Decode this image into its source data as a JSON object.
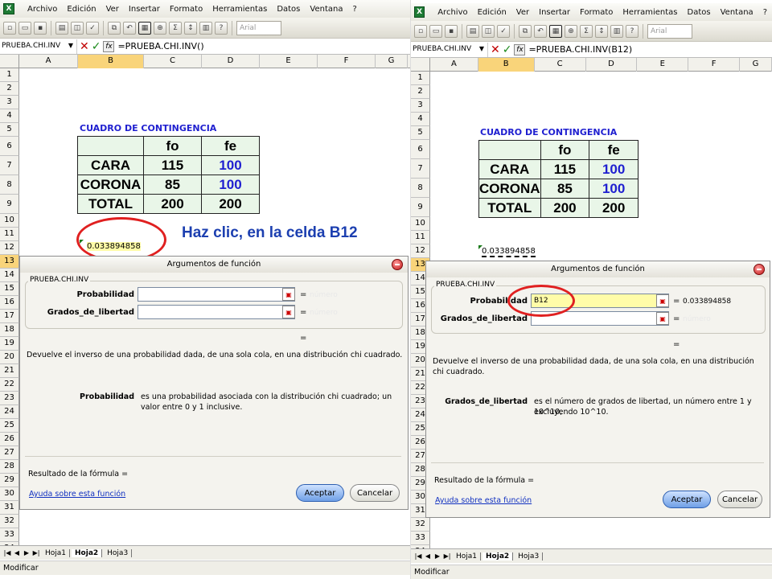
{
  "menu": [
    "Archivo",
    "Edición",
    "Ver",
    "Insertar",
    "Formato",
    "Herramientas",
    "Datos",
    "Ventana",
    "?"
  ],
  "font_name": "Arial",
  "columns": [
    "A",
    "B",
    "C",
    "D",
    "E",
    "F",
    "G"
  ],
  "rows": [
    "1",
    "2",
    "3",
    "4",
    "5",
    "6",
    "7",
    "8",
    "9",
    "10",
    "11",
    "12",
    "13",
    "14",
    "15",
    "16",
    "17",
    "18",
    "19",
    "20",
    "21",
    "22",
    "23",
    "24",
    "25",
    "26",
    "27",
    "28",
    "29",
    "30",
    "31",
    "32",
    "33",
    "34"
  ],
  "contingency": {
    "title": "CUADRO DE CONTINGENCIA",
    "headers": [
      "",
      "fo",
      "fe"
    ],
    "rows": [
      [
        "CARA",
        "115",
        "100"
      ],
      [
        "CORONA",
        "85",
        "100"
      ],
      [
        "TOTAL",
        "200",
        "200"
      ]
    ]
  },
  "cell_b12": "0.033894858",
  "sheet_tabs": [
    "Hoja1",
    "Hoja2",
    "Hoja3"
  ],
  "status": "Modificar",
  "left": {
    "namebox": "PRUEBA.CHI.INV",
    "formula": "=PRUEBA.CHI.INV()",
    "annotation": "Haz clic, en la celda B12",
    "dialog": {
      "title": "Argumentos de función",
      "group": "PRUEBA.CHI.INV",
      "arg1_label": "Probabilidad",
      "arg1_value": "",
      "arg1_hint": "número",
      "arg2_label": "Grados_de_libertad",
      "arg2_value": "",
      "arg2_hint": "número",
      "eq": "=",
      "description": "Devuelve el inverso de una probabilidad dada, de una sola cola, en una distribución chi cuadrado.",
      "param_name": "Probabilidad",
      "param_desc_1": "es una probabilidad asociada con la distribución chi cuadrado; un",
      "param_desc_2": "valor entre 0 y 1 inclusive.",
      "result": "Resultado de la fórmula =",
      "help": "Ayuda sobre esta función",
      "ok": "Aceptar",
      "cancel": "Cancelar"
    }
  },
  "right": {
    "namebox": "PRUEBA.CHI.INV",
    "formula": "=PRUEBA.CHI.INV(B12)",
    "dialog": {
      "title": "Argumentos de función",
      "group": "PRUEBA.CHI.INV",
      "arg1_label": "Probabilidad",
      "arg1_value": "B12",
      "arg1_result": "0.033894858",
      "arg2_label": "Grados_de_libertad",
      "arg2_value": "",
      "arg2_hint": "número",
      "eq": "=",
      "description": "Devuelve el inverso de una probabilidad dada, de una sola cola, en una distribución chi cuadrado.",
      "param_name": "Grados_de_libertad",
      "param_desc_1": "es el número de grados de libertad, un número entre 1 y 10^10,",
      "param_desc_2": "excluyendo 10^10.",
      "result": "Resultado de la fórmula =",
      "help": "Ayuda sobre esta función",
      "ok": "Aceptar",
      "cancel": "Cancelar"
    }
  }
}
